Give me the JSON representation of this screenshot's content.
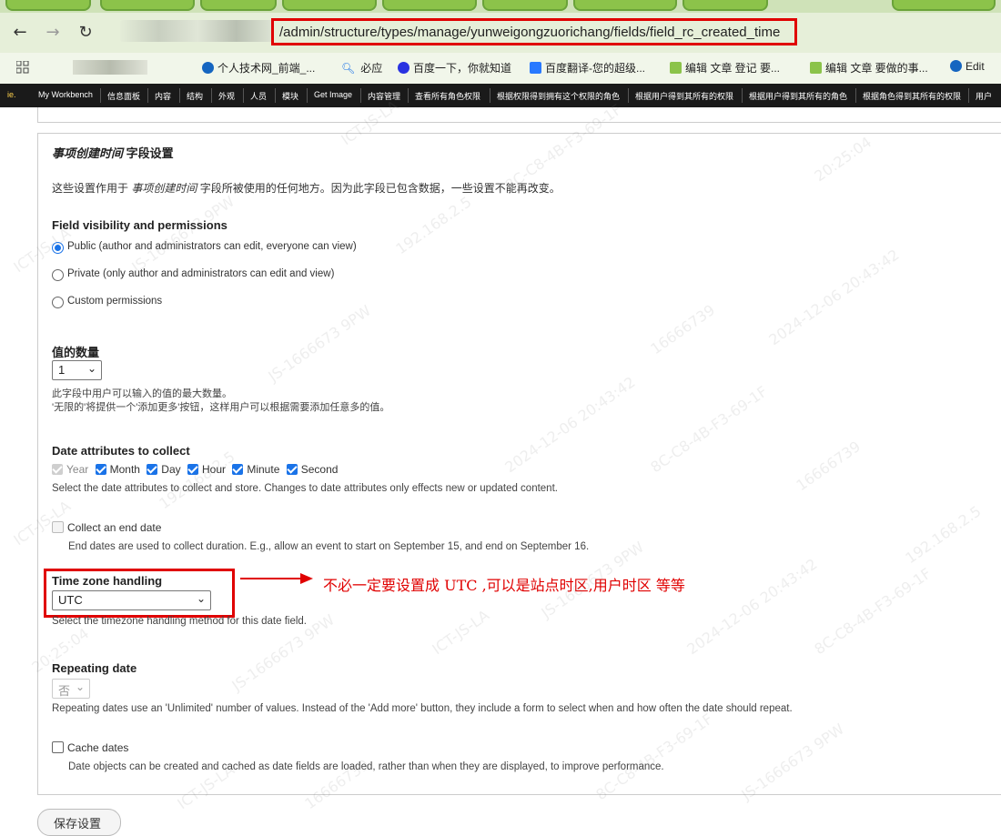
{
  "browser": {
    "nav": {
      "back": "←",
      "forward": "→",
      "reload": "↻"
    },
    "url": "/admin/structure/types/manage/yunweigongzuorichang/fields/field_rc_created_time",
    "bookmarks": [
      {
        "label": "个人技术网_前端_...",
        "icon_color": "#1565c0"
      },
      {
        "label": "必应",
        "icon_color": "#1a73e8"
      },
      {
        "label": "百度一下，你就知道",
        "icon_color": "#2932e1"
      },
      {
        "label": "百度翻译-您的超级...",
        "icon_color": "#2979ff"
      },
      {
        "label": "编辑 文章 登记 要...",
        "icon_color": "#8bc34a"
      },
      {
        "label": "编辑 文章 要做的事...",
        "icon_color": "#8bc34a"
      },
      {
        "label": "Edit",
        "icon_color": "#1565c0"
      }
    ],
    "apps_icon": "grid-icon"
  },
  "admin_bar": [
    "My Workbench",
    "信息面板",
    "内容",
    "结构",
    "外观",
    "人员",
    "模块",
    "Get Image",
    "内容管理",
    "查看所有角色权限",
    "根据权限得到拥有这个权限的角色",
    "根据用户得到其所有的权限",
    "根据用户得到其所有的角色",
    "根据角色得到其所有的权限",
    "用户"
  ],
  "page": {
    "section_title_em": "事项创建时间",
    "section_title_rest": " 字段设置",
    "intro_prefix": "这些设置作用于 ",
    "intro_em": "事项创建时间",
    "intro_suffix": " 字段所被使用的任何地方。因为此字段已包含数据，一些设置不能再改变。",
    "visibility": {
      "title": "Field visibility and permissions",
      "options": [
        {
          "label": "Public (author and administrators can edit, everyone can view)",
          "checked": true
        },
        {
          "label": "Private (only author and administrators can edit and view)",
          "checked": false
        },
        {
          "label": "Custom permissions",
          "checked": false
        }
      ]
    },
    "cardinality": {
      "title": "值的数量",
      "value": "1",
      "help1": "此字段中用户可以输入的值的最大数量。",
      "help2": "'无限的'将提供一个'添加更多'按钮，这样用户可以根据需要添加任意多的值。"
    },
    "date_attrs": {
      "title": "Date attributes to collect",
      "items": [
        {
          "label": "Year",
          "checked": true,
          "disabled": true
        },
        {
          "label": "Month",
          "checked": true,
          "disabled": false
        },
        {
          "label": "Day",
          "checked": true,
          "disabled": false
        },
        {
          "label": "Hour",
          "checked": true,
          "disabled": false
        },
        {
          "label": "Minute",
          "checked": true,
          "disabled": false
        },
        {
          "label": "Second",
          "checked": true,
          "disabled": false
        }
      ],
      "help": "Select the date attributes to collect and store. Changes to date attributes only effects new or updated content."
    },
    "end_date": {
      "label": "Collect an end date",
      "help": "End dates are used to collect duration. E.g., allow an event to start on September 15, and end on September 16."
    },
    "timezone": {
      "title": "Time zone handling",
      "value": "UTC",
      "help": "Select the timezone handling method for this date field."
    },
    "annotation": "不必一定要设置成 UTC ,可以是站点时区,用户时区 等等",
    "repeating": {
      "title": "Repeating date",
      "value": "否",
      "help": "Repeating dates use an 'Unlimited' number of values. Instead of the 'Add more' button, they include a form to select when and how often the date should repeat."
    },
    "cache": {
      "label": "Cache dates",
      "help": "Date objects can be created and cached as date fields are loaded, rather than when they are displayed, to improve performance."
    },
    "save_label": "保存设置"
  },
  "watermark": {
    "lines": [
      "ICT-JS-LA",
      "JS-1666673 9PW",
      "192.168.2.5",
      "8C-C8-4B-F3-69-1F",
      "2024-12-06 20:43:42",
      "16666739",
      "20:25:04"
    ]
  },
  "colors": {
    "accent": "#1a73e8",
    "annotation_red": "#e00000",
    "admin_bar": "#1a1a1a"
  }
}
